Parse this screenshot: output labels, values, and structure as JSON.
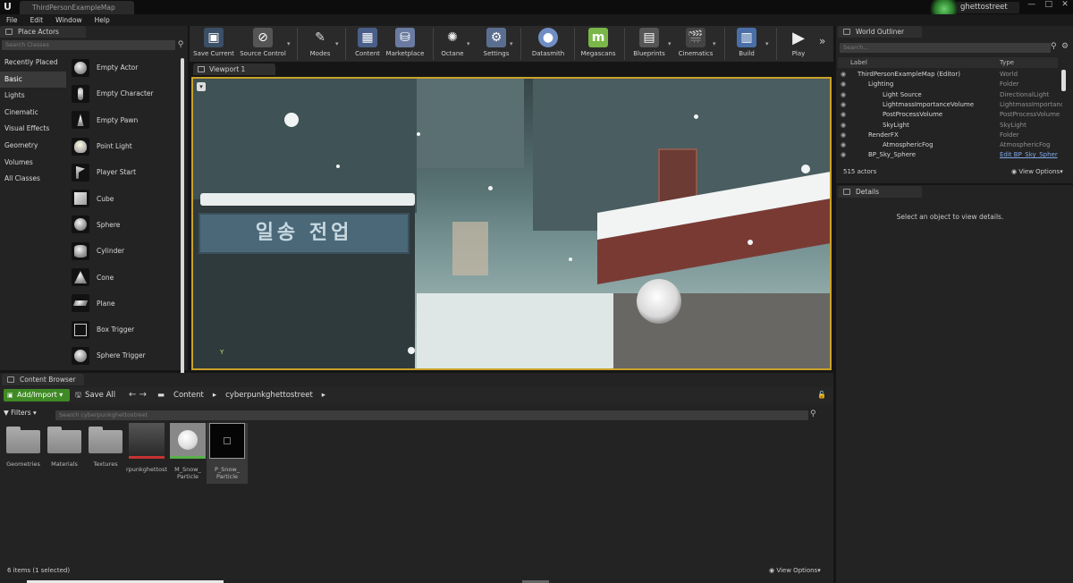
{
  "window": {
    "doc_tab": "ThirdPersonExampleMap",
    "user_name": "ghettostreet",
    "controls": [
      "—",
      "□",
      "✕"
    ]
  },
  "menu": [
    "File",
    "Edit",
    "Window",
    "Help"
  ],
  "place_actors": {
    "tab": "Place Actors",
    "search_placeholder": "Search Classes",
    "categories": [
      "Recently Placed",
      "Basic",
      "Lights",
      "Cinematic",
      "Visual Effects",
      "Geometry",
      "Volumes",
      "All Classes"
    ],
    "active_category": "Basic",
    "actors": [
      "Empty Actor",
      "Empty Character",
      "Empty Pawn",
      "Point Light",
      "Player Start",
      "Cube",
      "Sphere",
      "Cylinder",
      "Cone",
      "Plane",
      "Box Trigger",
      "Sphere Trigger"
    ]
  },
  "toolbar": [
    {
      "label": "Save Current",
      "icon": "save-icon"
    },
    {
      "label": "Source Control",
      "icon": "source-control-icon"
    },
    {
      "label": "Modes",
      "icon": "modes-icon"
    },
    {
      "label": "Content",
      "icon": "content-icon"
    },
    {
      "label": "Marketplace",
      "icon": "marketplace-icon"
    },
    {
      "label": "Octane",
      "icon": "octane-icon"
    },
    {
      "label": "Settings",
      "icon": "settings-icon"
    },
    {
      "label": "Datasmith",
      "icon": "datasmith-icon"
    },
    {
      "label": "Megascans",
      "icon": "megascans-icon"
    },
    {
      "label": "Blueprints",
      "icon": "blueprints-icon"
    },
    {
      "label": "Cinematics",
      "icon": "cinematics-icon"
    },
    {
      "label": "Build",
      "icon": "build-icon"
    },
    {
      "label": "Play",
      "icon": "play-icon"
    }
  ],
  "viewport": {
    "tab": "Viewport 1",
    "shop_sign_text": "일송 전업",
    "axis_label": "Y"
  },
  "world_outliner": {
    "tab": "World Outliner",
    "search_placeholder": "Search...",
    "col_label": "Label",
    "col_type": "Type",
    "rows": [
      {
        "label": "ThirdPersonExampleMap (Editor)",
        "type": "World",
        "indent": 0
      },
      {
        "label": "Lighting",
        "type": "Folder",
        "indent": 1
      },
      {
        "label": "Light Source",
        "type": "DirectionalLight",
        "indent": 2
      },
      {
        "label": "LightmassImportanceVolume",
        "type": "LightmassImportanc",
        "indent": 2
      },
      {
        "label": "PostProcessVolume",
        "type": "PostProcessVolume",
        "indent": 2
      },
      {
        "label": "SkyLight",
        "type": "SkyLight",
        "indent": 2
      },
      {
        "label": "RenderFX",
        "type": "Folder",
        "indent": 1
      },
      {
        "label": "AtmosphericFog",
        "type": "AtmosphericFog",
        "indent": 2
      },
      {
        "label": "BP_Sky_Sphere",
        "type": "Edit BP_Sky_Spher",
        "indent": 1
      }
    ],
    "count": "515 actors",
    "view_options": "View Options"
  },
  "details": {
    "tab": "Details",
    "empty_message": "Select an object to view details."
  },
  "content_browser": {
    "tab": "Content Browser",
    "add_import": "Add/Import",
    "save_all": "Save All",
    "breadcrumbs": [
      "Content",
      "cyberpunkghettostreet"
    ],
    "filters": "Filters",
    "search_placeholder": "Search cyberpunkghettostreet",
    "assets": [
      {
        "name": "Geometries",
        "kind": "folder"
      },
      {
        "name": "Materials",
        "kind": "folder"
      },
      {
        "name": "Textures",
        "kind": "folder"
      },
      {
        "name": "rpunkghettost",
        "kind": "map"
      },
      {
        "name": "M_Snow_\nParticle",
        "kind": "material"
      },
      {
        "name": "P_Snow_\nParticle",
        "kind": "particle"
      }
    ],
    "status": "6 items (1 selected)",
    "view_options": "View Options"
  }
}
